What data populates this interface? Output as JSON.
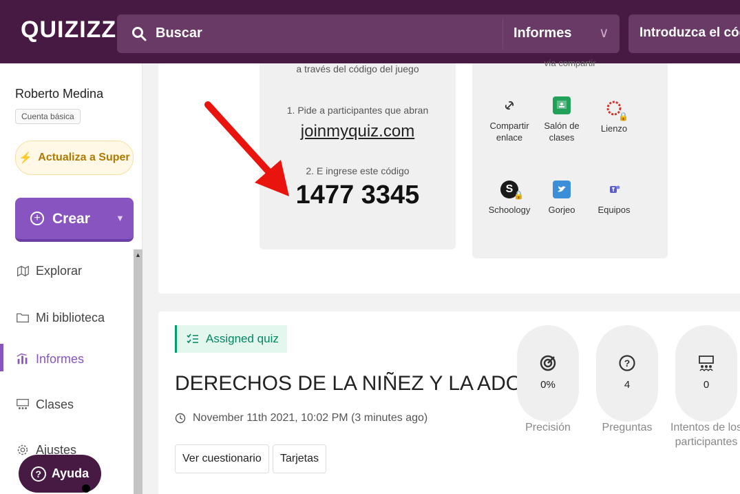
{
  "header": {
    "logo": "QUIZIZZ",
    "search_placeholder": "Buscar",
    "reports_label": "Informes",
    "code_placeholder": "Introduzca el código"
  },
  "sidebar": {
    "user_name": "Roberto Medina",
    "account_type": "Cuenta básica",
    "upgrade_label": "Actualiza a Super",
    "create_label": "Crear",
    "items": [
      {
        "label": "Explorar",
        "icon": "explore-icon"
      },
      {
        "label": "Mi biblioteca",
        "icon": "folder-icon"
      },
      {
        "label": "Informes",
        "icon": "reports-icon",
        "active": true
      },
      {
        "label": "Clases",
        "icon": "classes-icon"
      },
      {
        "label": "Ajustes",
        "icon": "settings-icon"
      }
    ],
    "help_label": "Ayuda"
  },
  "join": {
    "top_text": "a través del código del juego",
    "step1": "1. Pide a participantes que abran",
    "link": "joinmyquiz.com",
    "step2": "2. E ingrese este código",
    "code": "1477 3345"
  },
  "share": {
    "top_text": "vía compartir",
    "options": [
      {
        "label": "Compartir enlace",
        "icon": "link-icon"
      },
      {
        "label": "Salón de clases",
        "icon": "google-classroom-icon"
      },
      {
        "label": "Lienzo",
        "icon": "canvas-icon",
        "locked": true
      },
      {
        "label": "Schoology",
        "icon": "schoology-icon",
        "locked": true
      },
      {
        "label": "Gorjeo",
        "icon": "twitter-icon"
      },
      {
        "label": "Equipos",
        "icon": "teams-icon"
      }
    ]
  },
  "quiz": {
    "tag": "Assigned quiz",
    "title": "DERECHOS DE LA NIÑEZ Y LA ADOLESCENCIA",
    "date": "November 11th 2021, 10:02 PM (3 minutes ago)",
    "buttons": [
      "Ver cuestionario",
      "Tarjetas"
    ],
    "stats": [
      {
        "value": "0%",
        "label": "Precisión"
      },
      {
        "value": "4",
        "label": "Preguntas"
      },
      {
        "value": "0",
        "label": "Intentos de los participantes"
      }
    ]
  },
  "colors": {
    "brand": "#461a42",
    "accent": "#8854c0",
    "assigned": "#00875c",
    "arrow": "#e8140d"
  }
}
